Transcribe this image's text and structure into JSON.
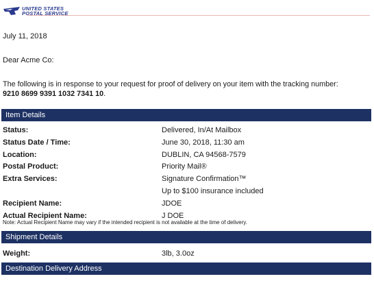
{
  "logo": {
    "line1": "UNITED STATES",
    "line2": "POSTAL SERVICE"
  },
  "letter": {
    "date": "July 11, 2018",
    "greeting": "Dear Acme Co:",
    "intro": "The following is in response to your request for proof of delivery on your item with the tracking number:",
    "tracking": "9210 8699 9391 1032 7341 10",
    "tracking_suffix": "."
  },
  "sections": {
    "item_details": "Item Details",
    "shipment_details": "Shipment Details",
    "destination": "Destination Delivery Address"
  },
  "items": [
    {
      "label": "Status:",
      "value": "Delivered, In/At Mailbox"
    },
    {
      "label": "Status Date / Time:",
      "value": "June 30, 2018, 11:30 am"
    },
    {
      "label": "Location:",
      "value": "DUBLIN, CA 94568-7579"
    },
    {
      "label": "Postal Product:",
      "value": "Priority Mail®"
    },
    {
      "label": "Extra Services:",
      "value": "Signature Confirmation™"
    },
    {
      "label": "",
      "value": "Up to $100 insurance included"
    },
    {
      "label": "Recipient Name:",
      "value": "JDOE"
    },
    {
      "label": "Actual Recipient Name:",
      "value": "J DOE"
    }
  ],
  "note": "Note: Actual Recipient Name may vary if the intended recipient is not available at the time of delivery.",
  "shipment": {
    "label": "Weight:",
    "value": "3lb, 3.0oz"
  },
  "colors": {
    "header_bar": "#1d3163",
    "logo_blue": "#2b3a8f"
  }
}
